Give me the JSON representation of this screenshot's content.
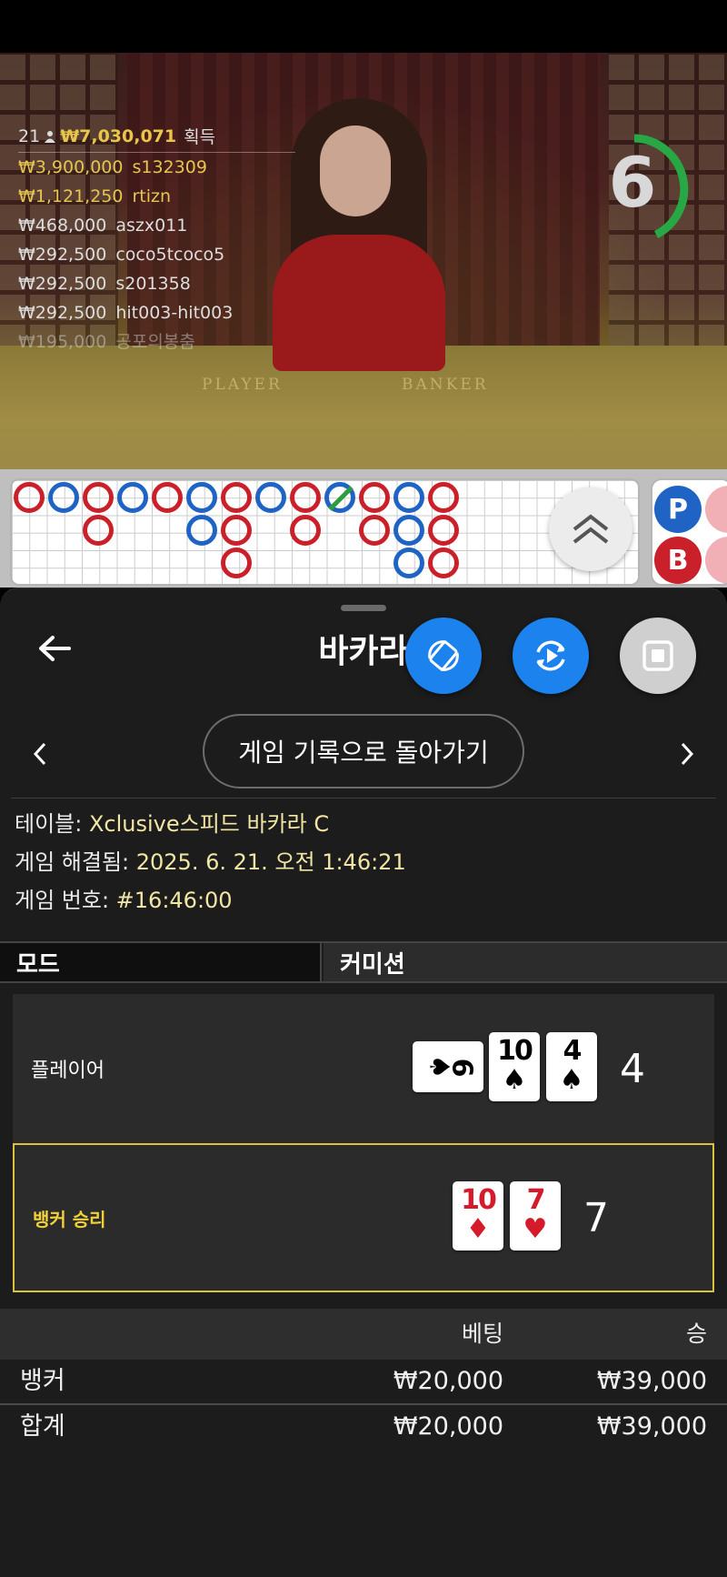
{
  "video": {
    "felt_labels": {
      "player": "PLAYER",
      "banker": "BANKER"
    },
    "countdown": "6",
    "winners_header": {
      "count": "21",
      "total": "₩7,030,071",
      "suffix": "획득"
    },
    "winners": [
      {
        "amount": "₩3,900,000",
        "name": "s132309"
      },
      {
        "amount": "₩1,121,250",
        "name": "rtizn"
      },
      {
        "amount": "₩468,000",
        "name": "aszx011"
      },
      {
        "amount": "₩292,500",
        "name": "coco5tcoco5"
      },
      {
        "amount": "₩292,500",
        "name": "s201358"
      },
      {
        "amount": "₩292,500",
        "name": "hit003-hit003"
      },
      {
        "amount": "₩195,000",
        "name": "공포의봉춤"
      }
    ]
  },
  "roadmap": {
    "side_labels": {
      "player": "P",
      "banker": "B"
    },
    "colors": {
      "banker": "#c9202a",
      "player": "#1f64c4"
    }
  },
  "sheet": {
    "title": "바카라",
    "icons": [
      "back-arrow-icon",
      "rotate-icon",
      "replay-icon",
      "stop-icon",
      "chevron-left-icon",
      "chevron-right-icon",
      "chevron-double-up-icon"
    ],
    "back_to_history": "게임 기록으로 돌아가기",
    "info": {
      "table_label": "테이블: ",
      "table_value": "Xclusive스피드 바카라 C",
      "resolved_label": "게임 해결됨: ",
      "resolved_value": "2025. 6. 21. 오전 1:46:21",
      "number_label": "게임 번호: ",
      "number_value": "#16:46:00"
    },
    "tabs": {
      "mode": "모드",
      "commission": "커미션"
    },
    "player": {
      "label": "플레이어",
      "cards": [
        {
          "rank": "6",
          "suit": "♠",
          "color": "black",
          "sideways": true
        },
        {
          "rank": "10",
          "suit": "♠",
          "color": "black",
          "sideways": false
        },
        {
          "rank": "4",
          "suit": "♠",
          "color": "black",
          "sideways": false
        }
      ],
      "total": "4"
    },
    "banker": {
      "label": "뱅커 승리",
      "cards": [
        {
          "rank": "10",
          "suit": "♦",
          "color": "red",
          "sideways": false
        },
        {
          "rank": "7",
          "suit": "♥",
          "color": "red",
          "sideways": false
        }
      ],
      "total": "7"
    },
    "bets": {
      "headers": {
        "bet": "베팅",
        "win": "승"
      },
      "rows": [
        {
          "label": "뱅커",
          "bet": "₩20,000",
          "win": "₩39,000"
        },
        {
          "label": "합계",
          "bet": "₩20,000",
          "win": "₩39,000"
        }
      ]
    },
    "accent": "#1b82ee",
    "win_highlight": "#d9c23a"
  }
}
